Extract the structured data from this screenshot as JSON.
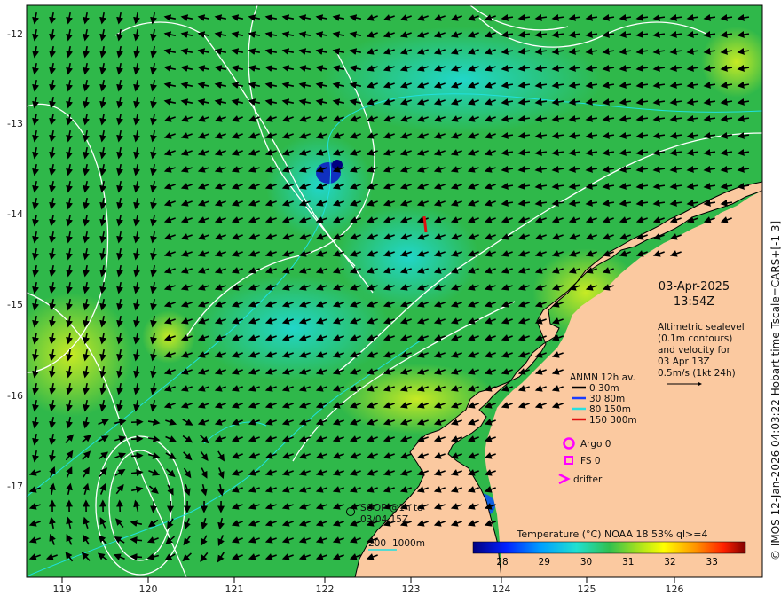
{
  "map": {
    "lon_ticks": [
      "119",
      "120",
      "121",
      "122",
      "123",
      "124",
      "125",
      "126"
    ],
    "lat_ticks": [
      "-12",
      "-13",
      "-14",
      "-15",
      "-16",
      "-17"
    ]
  },
  "datetime": {
    "date": "03-Apr-2025",
    "time": "13:54Z"
  },
  "altimetry": {
    "lines": [
      "Altimetric sealevel",
      "(0.1m contours)",
      "and velocity for",
      "03 Apr 13Z",
      "0.5m/s (1kt 24h)"
    ]
  },
  "mooring_legend": {
    "title": "ANMN 12h av.",
    "items": [
      {
        "label": "0 30m",
        "color": "#000000"
      },
      {
        "label": "30 80m",
        "color": "#1a3cff"
      },
      {
        "label": "80 150m",
        "color": "#28e0e0"
      },
      {
        "label": "150 300m",
        "color": "#e01010"
      }
    ]
  },
  "platforms": {
    "argo": "Argo 0",
    "fs": "FS 0",
    "drifter": "drifter",
    "accent": "#ff00ff"
  },
  "soop": {
    "line1": "SOOP @1h to",
    "line2": "03/04 15Z"
  },
  "bathy": {
    "label1": "200",
    "label2": "1000m"
  },
  "colorbar": {
    "title": "Temperature (°C) NOAA 18 53% ql>=4",
    "ticks": [
      "28",
      "29",
      "30",
      "31",
      "32",
      "33"
    ],
    "min": 27.3,
    "max": 33.8
  },
  "credit": "© IMOS 12-Jan-2026 04:03:22 Hobart time Tscale=CARS+[-1 3]"
}
